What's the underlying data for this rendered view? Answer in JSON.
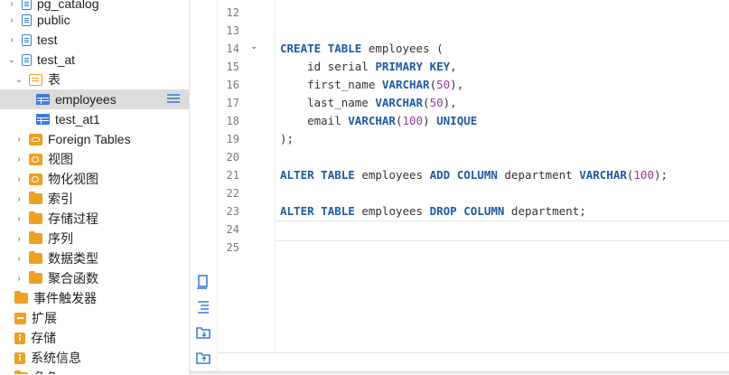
{
  "tree": {
    "items": [
      {
        "label": "pg_catalog",
        "icon": "schema-icon",
        "chevron": "›"
      },
      {
        "label": "public",
        "icon": "schema-icon",
        "chevron": "›"
      },
      {
        "label": "test",
        "icon": "schema-icon",
        "chevron": "›"
      },
      {
        "label": "test_at",
        "icon": "schema-icon",
        "chevron": "⌄"
      },
      {
        "label": "表",
        "icon": "tables-folder-icon",
        "chevron": "⌄"
      },
      {
        "label": "employees",
        "icon": "table-icon",
        "chevron": ""
      },
      {
        "label": "test_at1",
        "icon": "table-icon",
        "chevron": ""
      },
      {
        "label": "Foreign Tables",
        "icon": "foreign-table-icon",
        "chevron": "›"
      },
      {
        "label": "视图",
        "icon": "view-icon",
        "chevron": "›"
      },
      {
        "label": "物化视图",
        "icon": "view-icon",
        "chevron": "›"
      },
      {
        "label": "索引",
        "icon": "folder-icon",
        "chevron": "›"
      },
      {
        "label": "存储过程",
        "icon": "folder-icon",
        "chevron": "›"
      },
      {
        "label": "序列",
        "icon": "folder-icon",
        "chevron": "›"
      },
      {
        "label": "数据类型",
        "icon": "folder-icon",
        "chevron": "›"
      },
      {
        "label": "聚合函数",
        "icon": "folder-icon",
        "chevron": "›"
      },
      {
        "label": "事件触发器",
        "icon": "folder-icon",
        "chevron": ""
      },
      {
        "label": "扩展",
        "icon": "extension-icon",
        "chevron": ""
      },
      {
        "label": "存储",
        "icon": "storage-icon",
        "chevron": ""
      },
      {
        "label": "系统信息",
        "icon": "info-icon",
        "chevron": ""
      },
      {
        "label": "角色",
        "icon": "folder-icon",
        "chevron": ""
      }
    ]
  },
  "editor": {
    "line_numbers": [
      "12",
      "13",
      "14",
      "15",
      "16",
      "17",
      "18",
      "19",
      "20",
      "21",
      "22",
      "23",
      "24",
      "25"
    ],
    "lines": [
      {
        "t": "",
        "k": []
      },
      {
        "t": "",
        "k": []
      },
      {
        "t": "CREATE TABLE employees (",
        "k": [
          "CREATE",
          "TABLE"
        ]
      },
      {
        "t": "    id serial PRIMARY KEY,",
        "k": [
          "PRIMARY",
          "KEY"
        ]
      },
      {
        "t": "    first_name VARCHAR(50),",
        "k": [
          "VARCHAR"
        ]
      },
      {
        "t": "    last_name VARCHAR(50),",
        "k": [
          "VARCHAR"
        ]
      },
      {
        "t": "    email VARCHAR(100) UNIQUE",
        "k": [
          "VARCHAR",
          "UNIQUE"
        ]
      },
      {
        "t": ");",
        "k": []
      },
      {
        "t": "",
        "k": []
      },
      {
        "t": "ALTER TABLE employees ADD COLUMN department VARCHAR(100);",
        "k": [
          "ALTER",
          "TABLE",
          "ADD",
          "COLUMN",
          "VARCHAR"
        ]
      },
      {
        "t": "",
        "k": []
      },
      {
        "t": "ALTER TABLE employees DROP COLUMN department;",
        "k": [
          "ALTER",
          "TABLE",
          "DROP",
          "COLUMN"
        ]
      },
      {
        "t": "",
        "k": []
      },
      {
        "t": "",
        "k": []
      }
    ],
    "fold_marker": "⌄"
  },
  "tools": [
    "new-query-icon",
    "format-icon",
    "save-to-folder-icon",
    "open-from-folder-icon"
  ],
  "colors": {
    "keyword": "#1e5aa6",
    "number": "#9b3a99",
    "folder": "#f0a020",
    "accent": "#3b7ddd"
  }
}
